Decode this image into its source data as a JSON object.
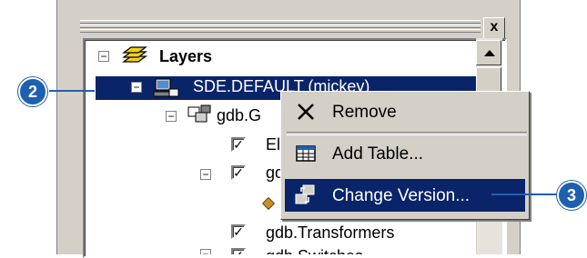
{
  "window": {
    "close_label": "x"
  },
  "tree": {
    "layers_label": "Layers",
    "connection_label": "SDE.DEFAULT (mickey)",
    "group_label": "gdb.G",
    "row3_label": "El",
    "row4_label": "gd",
    "transformers_label": "gdb.Transformers",
    "partial_bottom_label": "gdb.Switches",
    "expand_minus": "−",
    "check_mark": "✓"
  },
  "context_menu": {
    "items": [
      {
        "label": "Remove",
        "icon": "remove-x-icon"
      },
      {
        "label": "Add Table...",
        "icon": "add-table-icon"
      },
      {
        "label": "Change Version...",
        "icon": "change-version-icon"
      }
    ]
  },
  "callouts": {
    "step2": "2",
    "step3": "3"
  },
  "colors": {
    "selection": "#0a246a",
    "callout": "#1f5fb0",
    "window_face": "#d4d0c8"
  }
}
